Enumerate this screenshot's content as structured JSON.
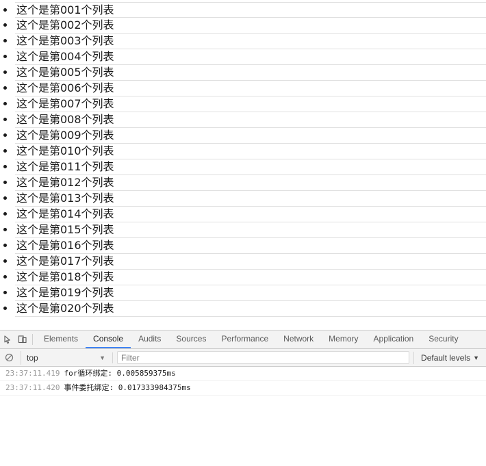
{
  "page": {
    "list_items": [
      "这个是第001个列表",
      "这个是第002个列表",
      "这个是第003个列表",
      "这个是第004个列表",
      "这个是第005个列表",
      "这个是第006个列表",
      "这个是第007个列表",
      "这个是第008个列表",
      "这个是第009个列表",
      "这个是第010个列表",
      "这个是第011个列表",
      "这个是第012个列表",
      "这个是第013个列表",
      "这个是第014个列表",
      "这个是第015个列表",
      "这个是第016个列表",
      "这个是第017个列表",
      "这个是第018个列表",
      "这个是第019个列表",
      "这个是第020个列表"
    ]
  },
  "devtools": {
    "icons": {
      "inspect": "inspect-element-icon",
      "device": "device-toolbar-icon",
      "clear": "clear-console-icon"
    },
    "tabs": [
      {
        "label": "Elements",
        "active": false
      },
      {
        "label": "Console",
        "active": true
      },
      {
        "label": "Audits",
        "active": false
      },
      {
        "label": "Sources",
        "active": false
      },
      {
        "label": "Performance",
        "active": false
      },
      {
        "label": "Network",
        "active": false
      },
      {
        "label": "Memory",
        "active": false
      },
      {
        "label": "Application",
        "active": false
      },
      {
        "label": "Security",
        "active": false
      }
    ],
    "filterbar": {
      "context": "top",
      "context_caret": "▼",
      "filter_value": "",
      "filter_placeholder": "Filter",
      "levels": "Default levels",
      "levels_caret": "▼"
    },
    "console_messages": [
      {
        "timestamp": "23:37:11.419",
        "text": "for循环绑定: 0.005859375ms"
      },
      {
        "timestamp": "23:37:11.420",
        "text": "事件委托绑定: 0.017333984375ms"
      }
    ]
  },
  "colors": {
    "accent": "#4285f4",
    "toolbar_bg": "#f3f3f3",
    "border": "#cdcdcd",
    "list_border": "#e0e0e0",
    "timestamp": "#999999"
  }
}
